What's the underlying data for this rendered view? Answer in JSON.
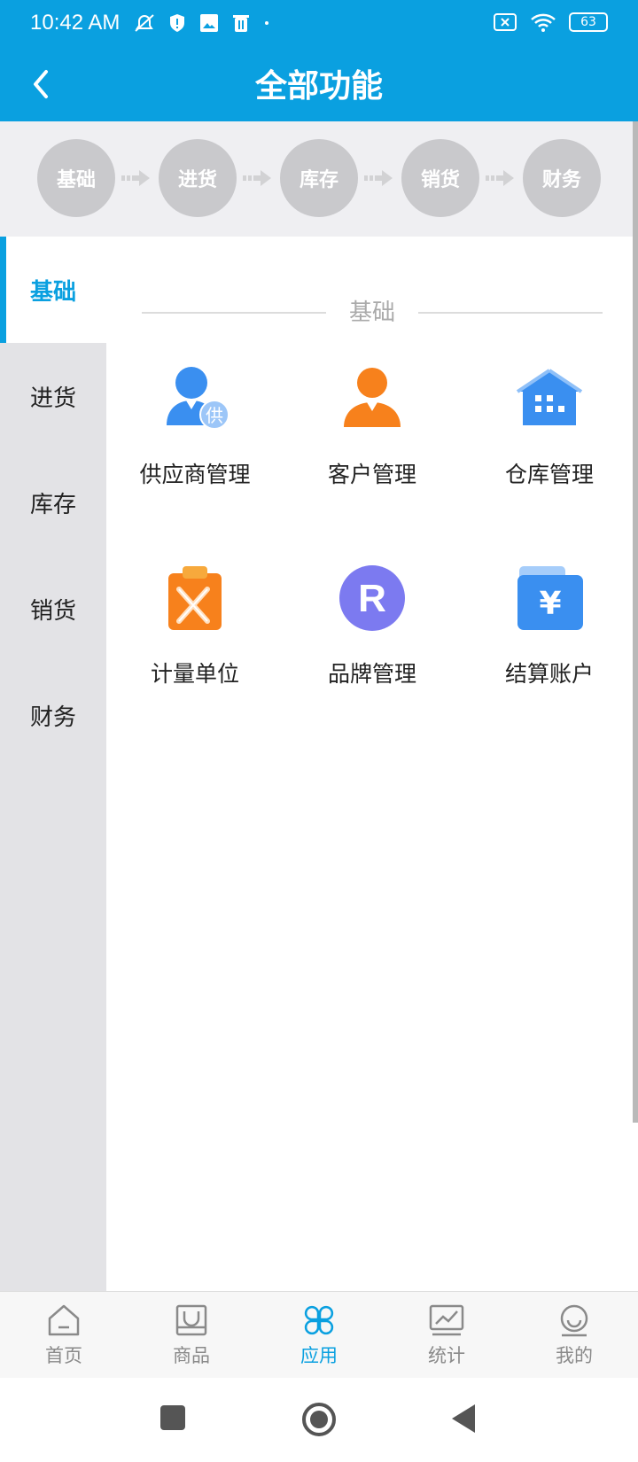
{
  "status_bar": {
    "time": "10:42 AM",
    "battery": "63"
  },
  "header": {
    "title": "全部功能"
  },
  "steps": [
    "基础",
    "进货",
    "库存",
    "销货",
    "财务"
  ],
  "sidebar": {
    "items": [
      {
        "label": "基础",
        "active": true
      },
      {
        "label": "进货"
      },
      {
        "label": "库存"
      },
      {
        "label": "销货"
      },
      {
        "label": "财务"
      }
    ]
  },
  "section": {
    "title": "基础",
    "items": [
      {
        "label": "供应商管理",
        "icon": "supplier-icon",
        "badge": "供"
      },
      {
        "label": "客户管理",
        "icon": "customer-icon"
      },
      {
        "label": "仓库管理",
        "icon": "warehouse-icon"
      },
      {
        "label": "计量单位",
        "icon": "measure-unit-icon"
      },
      {
        "label": "品牌管理",
        "icon": "brand-icon",
        "badge": "R"
      },
      {
        "label": "结算账户",
        "icon": "settlement-account-icon",
        "badge": "¥"
      }
    ]
  },
  "tabbar": {
    "items": [
      {
        "label": "首页",
        "icon": "home-icon"
      },
      {
        "label": "商品",
        "icon": "goods-icon"
      },
      {
        "label": "应用",
        "icon": "apps-icon",
        "active": true
      },
      {
        "label": "统计",
        "icon": "stats-icon"
      },
      {
        "label": "我的",
        "icon": "profile-icon"
      }
    ]
  },
  "colors": {
    "primary": "#0aa0e0",
    "step_gray": "#c9c9cc",
    "sidebar_bg": "#e3e3e6"
  }
}
